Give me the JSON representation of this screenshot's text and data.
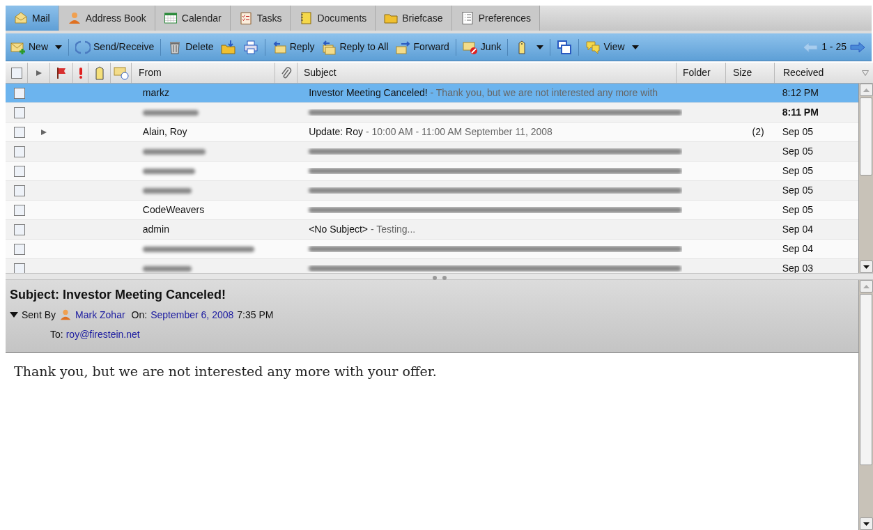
{
  "tabs": [
    {
      "label": "Mail",
      "selected": true
    },
    {
      "label": "Address Book",
      "selected": false
    },
    {
      "label": "Calendar",
      "selected": false
    },
    {
      "label": "Tasks",
      "selected": false
    },
    {
      "label": "Documents",
      "selected": false
    },
    {
      "label": "Briefcase",
      "selected": false
    },
    {
      "label": "Preferences",
      "selected": false
    }
  ],
  "toolbar": [
    {
      "kind": "button",
      "label": "New",
      "dropdown": true
    },
    {
      "kind": "separator"
    },
    {
      "kind": "button",
      "label": "Send/Receive",
      "dropdown": false
    },
    {
      "kind": "separator"
    },
    {
      "kind": "button",
      "label": "Delete",
      "dropdown": false
    },
    {
      "kind": "button",
      "dropdown": false
    },
    {
      "kind": "button",
      "dropdown": false
    },
    {
      "kind": "separator"
    },
    {
      "kind": "button",
      "label": "Reply",
      "dropdown": false
    },
    {
      "kind": "button",
      "label": "Reply to All",
      "dropdown": false
    },
    {
      "kind": "button",
      "label": "Forward",
      "dropdown": false
    },
    {
      "kind": "separator"
    },
    {
      "kind": "button",
      "label": "Junk",
      "dropdown": false
    },
    {
      "kind": "separator"
    },
    {
      "kind": "button",
      "dropdown": true
    },
    {
      "kind": "separator"
    },
    {
      "kind": "button",
      "dropdown": false
    },
    {
      "kind": "separator"
    },
    {
      "kind": "button",
      "label": "View",
      "dropdown": true
    }
  ],
  "select_all": {
    "checked": false
  },
  "pager": "1 - 25",
  "columns": {
    "from": "From",
    "subject": "Subject",
    "folder": "Folder",
    "size": "Size",
    "received": "Received"
  },
  "rows": [
    {
      "kind": "message",
      "checked": false,
      "selected": true,
      "unread": false,
      "thread": false,
      "from": "markz",
      "subject": "Investor Meeting Canceled!",
      "fragment": " - Thank you, but we are not interested any more with",
      "received": "8:12 PM"
    },
    {
      "kind": "blurred",
      "checked": false,
      "selected": false,
      "unread": true,
      "thread": false,
      "received": "8:11 PM"
    },
    {
      "kind": "message",
      "checked": false,
      "selected": false,
      "unread": false,
      "thread": true,
      "from": "Alain, Roy",
      "subject": "Update: Roy",
      "fragment": " - 10:00 AM - 11:00 AM September 11, 2008",
      "size": "(2)",
      "received": "Sep 05"
    },
    {
      "kind": "blurred",
      "checked": false,
      "selected": false,
      "unread": false,
      "thread": false,
      "received": "Sep 05"
    },
    {
      "kind": "blurred",
      "checked": false,
      "selected": false,
      "unread": false,
      "thread": false,
      "received": "Sep 05"
    },
    {
      "kind": "blurred",
      "checked": false,
      "selected": false,
      "unread": false,
      "thread": false,
      "received": "Sep 05"
    },
    {
      "kind": "message-blurred-subject",
      "checked": false,
      "selected": false,
      "unread": false,
      "thread": false,
      "from": "CodeWeavers",
      "received": "Sep 05"
    },
    {
      "kind": "message",
      "checked": false,
      "selected": false,
      "unread": false,
      "thread": false,
      "from": "admin",
      "subject": "<No Subject>",
      "fragment": " - Testing...",
      "received": "Sep 04"
    },
    {
      "kind": "blurred",
      "checked": false,
      "selected": false,
      "unread": false,
      "thread": false,
      "received": "Sep 04"
    },
    {
      "kind": "blurred",
      "checked": false,
      "selected": false,
      "unread": false,
      "thread": false,
      "received": "Sep 03"
    }
  ],
  "preview": {
    "subject": "Subject: Investor Meeting Canceled!",
    "expanded": true,
    "sent_by_label": "Sent By",
    "sender": "Mark Zohar",
    "on_label": "On:",
    "date": "September 6, 2008",
    "time": "7:35 PM",
    "to_label": "To:",
    "to": "roy@firestein.net",
    "body": "Thank you, but we are not interested any more with your offer."
  }
}
